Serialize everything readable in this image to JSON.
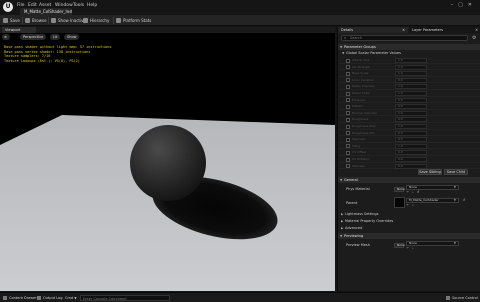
{
  "app": {
    "menu": [
      "File",
      "Edit",
      "Asset",
      "Window",
      "Tools",
      "Help"
    ],
    "document_tab": "M_Matte_ColShader_Inst",
    "window_controls": [
      "–",
      "▢",
      "✕"
    ]
  },
  "toolbar": {
    "save": "Save",
    "browse": "Browse",
    "show_inactive": "Show Inactive",
    "hierarchy": "Hierarchy",
    "platform_stats": "Platform Stats"
  },
  "viewport": {
    "tab": "Viewport",
    "buttons": [
      "Perspective",
      "Lit",
      "Show"
    ],
    "stats": [
      "Base pass shader without light map: 57 instructions",
      "Base pass vertex shader: 138 instructions",
      "Texture samplers: 7/16",
      "Texture Lookups (Est.): VS(0), PS(2)"
    ]
  },
  "details": {
    "tab_details": "Details",
    "tab_layer": "Layer Parameters",
    "search_placeholder": "Search",
    "section_param_groups": "Parameter Groups",
    "subsection_global": "Global Scalar Parameter Values",
    "params": [
      {
        "name": "Albedo Tint",
        "value": "1.0"
      },
      {
        "name": "AO Strength",
        "value": "1.0"
      },
      {
        "name": "Base Scale",
        "value": "1.0"
      },
      {
        "name": "Color Variation",
        "value": "0.0"
      },
      {
        "name": "Detail Intensity",
        "value": "1.0"
      },
      {
        "name": "Detail Scale",
        "value": "1.0"
      },
      {
        "name": "Emissive",
        "value": "0.0"
      },
      {
        "name": "Metallic",
        "value": "0.0"
      },
      {
        "name": "Normal Intensity",
        "value": "1.0"
      },
      {
        "name": "Roughness",
        "value": "0.5"
      },
      {
        "name": "Roughness Max",
        "value": "1.0"
      },
      {
        "name": "Roughness Min",
        "value": "0.0"
      },
      {
        "name": "Specular",
        "value": "0.5"
      },
      {
        "name": "Tiling",
        "value": "1.0"
      },
      {
        "name": "UV Offset",
        "value": "0.0"
      },
      {
        "name": "UV Rotation",
        "value": "0.0"
      },
      {
        "name": "Wetness",
        "value": "0.0"
      }
    ],
    "save_sibling": "Save Sibling",
    "save_child": "Save Child",
    "section_general": "General",
    "phys_material_label": "Phys Material",
    "phys_material_none": "None",
    "phys_material_value": "None",
    "parent_label": "Parent",
    "parent_value": "M_Matte_ColShader",
    "lightmass_settings": "Lightmass Settings",
    "material_property_overrides": "Material Property Overrides",
    "advanced": "Advanced",
    "section_previewing": "Previewing",
    "preview_mesh_label": "Preview Mesh",
    "preview_mesh_none": "None",
    "preview_mesh_value": "None"
  },
  "statusbar": {
    "content_drawer": "Content Drawer",
    "output_log": "Output Log",
    "cmd": "Cmd",
    "cmd_placeholder": "Enter Console Command",
    "source_control": "Source Control"
  },
  "colors": {
    "accent_yellow": "#e8d000",
    "panel_bg": "#1c1c1c",
    "toolbar_bg": "#242424"
  }
}
